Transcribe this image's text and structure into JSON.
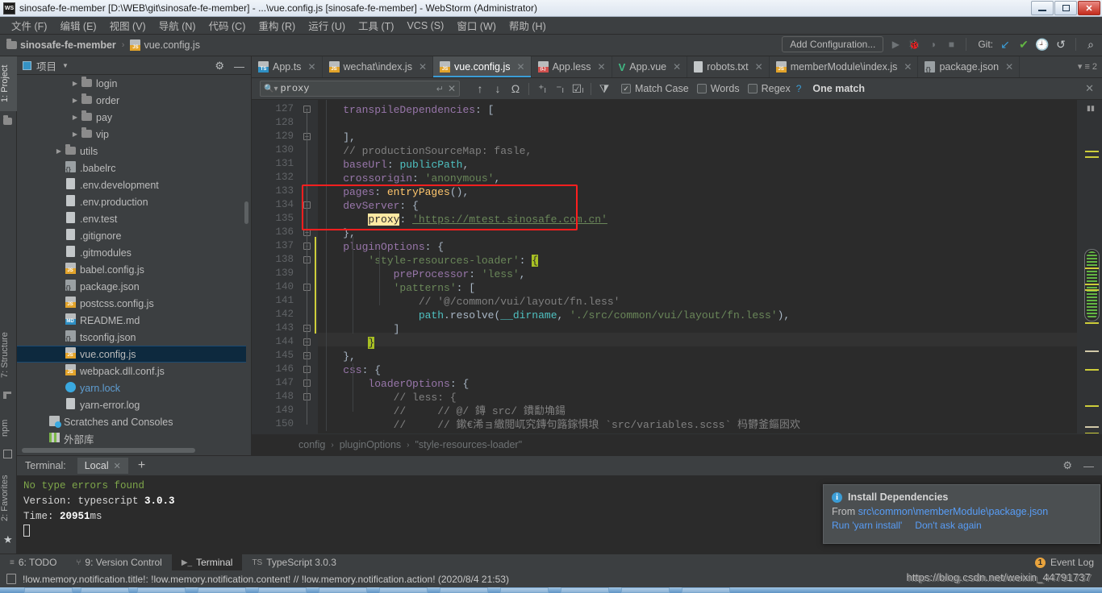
{
  "window": {
    "title": "sinosafe-fe-member [D:\\WEB\\git\\sinosafe-fe-member] - ...\\vue.config.js [sinosafe-fe-member] - WebStorm (Administrator)",
    "app_icon": "WS",
    "minimize": "minimize-icon",
    "maximize": "restore-icon",
    "close": "✕"
  },
  "menubar": [
    {
      "label": "文件 (F)"
    },
    {
      "label": "编辑 (E)"
    },
    {
      "label": "视图 (V)"
    },
    {
      "label": "导航 (N)"
    },
    {
      "label": "代码 (C)"
    },
    {
      "label": "重构 (R)"
    },
    {
      "label": "运行 (U)"
    },
    {
      "label": "工具 (T)"
    },
    {
      "label": "VCS (S)"
    },
    {
      "label": "窗口 (W)"
    },
    {
      "label": "帮助 (H)"
    }
  ],
  "navbar": {
    "breadcrumb_project": "sinosafe-fe-member",
    "breadcrumb_sep": "›",
    "breadcrumb_file": "vue.config.js",
    "add_configuration": "Add Configuration...",
    "git_label": "Git:",
    "icons": [
      "run-icon",
      "debug-icon",
      "run-coverage-icon",
      "stop-icon",
      "git-update-icon",
      "git-commit-icon",
      "git-history-icon",
      "git-rollback-icon",
      "search-everywhere-icon"
    ]
  },
  "left_strip": [
    {
      "label": "1: Project",
      "active": true
    },
    {
      "label": "7: Structure",
      "active": false
    },
    {
      "label": "npm",
      "active": false
    },
    {
      "label": "2: Favorites",
      "active": false
    }
  ],
  "project_panel": {
    "title": "项目",
    "settings_icon": "gear-icon",
    "hide_icon": "minimize-icon",
    "tree": [
      {
        "label": "login",
        "icon": "folder",
        "indent": 3,
        "arrow": true,
        "selected": false
      },
      {
        "label": "order",
        "icon": "folder",
        "indent": 3,
        "arrow": true,
        "selected": false
      },
      {
        "label": "pay",
        "icon": "folder",
        "indent": 3,
        "arrow": true,
        "selected": false
      },
      {
        "label": "vip",
        "icon": "folder",
        "indent": 3,
        "arrow": true,
        "selected": false
      },
      {
        "label": "utils",
        "icon": "folder",
        "indent": 2,
        "arrow": true,
        "selected": false
      },
      {
        "label": ".babelrc",
        "icon": "json",
        "indent": 2,
        "arrow": false,
        "selected": false
      },
      {
        "label": ".env.development",
        "icon": "txt",
        "indent": 2,
        "arrow": false,
        "selected": false
      },
      {
        "label": ".env.production",
        "icon": "txt",
        "indent": 2,
        "arrow": false,
        "selected": false
      },
      {
        "label": ".env.test",
        "icon": "txt",
        "indent": 2,
        "arrow": false,
        "selected": false
      },
      {
        "label": ".gitignore",
        "icon": "txt",
        "indent": 2,
        "arrow": false,
        "selected": false
      },
      {
        "label": ".gitmodules",
        "icon": "txt",
        "indent": 2,
        "arrow": false,
        "selected": false
      },
      {
        "label": "babel.config.js",
        "icon": "js",
        "indent": 2,
        "arrow": false,
        "selected": false
      },
      {
        "label": "package.json",
        "icon": "json",
        "indent": 2,
        "arrow": false,
        "selected": false
      },
      {
        "label": "postcss.config.js",
        "icon": "js",
        "indent": 2,
        "arrow": false,
        "selected": false
      },
      {
        "label": "README.md",
        "icon": "md",
        "indent": 2,
        "arrow": false,
        "selected": false
      },
      {
        "label": "tsconfig.json",
        "icon": "json",
        "indent": 2,
        "arrow": false,
        "selected": false
      },
      {
        "label": "vue.config.js",
        "icon": "js",
        "indent": 2,
        "arrow": false,
        "selected": true
      },
      {
        "label": "webpack.dll.conf.js",
        "icon": "js",
        "indent": 2,
        "arrow": false,
        "selected": false
      },
      {
        "label": "yarn.lock",
        "icon": "yarn",
        "indent": 2,
        "arrow": false,
        "selected": false
      },
      {
        "label": "yarn-error.log",
        "icon": "txt",
        "indent": 2,
        "arrow": false,
        "selected": false
      },
      {
        "label": "Scratches and Consoles",
        "icon": "scratch",
        "indent": 1,
        "arrow": false,
        "selected": false
      },
      {
        "label": "外部库",
        "icon": "lib",
        "indent": 1,
        "arrow": false,
        "selected": false
      }
    ]
  },
  "editor_tabs": [
    {
      "label": "App.ts",
      "icon": "ts",
      "active": false
    },
    {
      "label": "wechat\\index.js",
      "icon": "js",
      "active": false
    },
    {
      "label": "vue.config.js",
      "icon": "js",
      "active": true
    },
    {
      "label": "App.less",
      "icon": "less",
      "active": false
    },
    {
      "label": "App.vue",
      "icon": "vue",
      "active": false
    },
    {
      "label": "robots.txt",
      "icon": "txt",
      "active": false
    },
    {
      "label": "memberModule\\index.js",
      "icon": "js",
      "active": false
    },
    {
      "label": "package.json",
      "icon": "json",
      "active": false
    }
  ],
  "editor_tabs_overflow": "2",
  "find_bar": {
    "query": "proxy",
    "placeholder": "Find",
    "match_case": {
      "label": "Match Case",
      "checked": true
    },
    "words": {
      "label": "Words",
      "checked": false
    },
    "regex": {
      "label": "Regex",
      "checked": false
    },
    "help": "?",
    "result": "One match",
    "icons": [
      "prev-match-icon",
      "next-match-icon",
      "select-all-occurrences-icon",
      "add-line-icon",
      "remove-line-icon",
      "select-occurrences-icon",
      "filter-icon"
    ],
    "close": "✕"
  },
  "code": {
    "first_line_number": 127,
    "highlighted_line": 144,
    "lines": [
      {
        "n": 127,
        "html": "<span class='indent'>    </span><span class='prop'>transpileDependencies</span><span class='plain'>: [</span>"
      },
      {
        "n": 128,
        "html": ""
      },
      {
        "n": 129,
        "html": "<span class='plain'>    ],</span>"
      },
      {
        "n": 130,
        "html": "<span class='cm'>    // productionSourceMap: fasle,</span>"
      },
      {
        "n": 131,
        "html": "<span class='prop'>    baseUrl</span><span class='plain'>: </span><span class='teal'>publicPath</span><span class='plain'>,</span>"
      },
      {
        "n": 132,
        "html": "<span class='prop'>    crossorigin</span><span class='plain'>: </span><span class='str'>'anonymous'</span><span class='plain'>,</span>"
      },
      {
        "n": 133,
        "html": "<span class='prop'>    pages</span><span class='plain'>: </span><span class='fn'>entryPages</span><span class='plain'>(),</span>"
      },
      {
        "n": 134,
        "html": "<span class='prop'>    devServer</span><span class='plain'>: {</span>"
      },
      {
        "n": 135,
        "html": "<span class='plain'>        </span><span class='sel-hl'>proxy</span><span class='plain'>: </span><span class='str linkund'>'https://mtest.sinosafe.com.cn'</span>"
      },
      {
        "n": 136,
        "html": "<span class='plain'>    },</span>"
      },
      {
        "n": 137,
        "html": "<span class='prop'>    pluginOptions</span><span class='plain'>: {</span>"
      },
      {
        "n": 138,
        "html": "<span class='plain'>        </span><span class='str'>'style-resources-loader'</span><span class='plain'>: </span><span class='grn-hl'>{</span>"
      },
      {
        "n": 139,
        "html": "<span class='plain'>            </span><span class='prop'>preProcessor</span><span class='plain'>: </span><span class='str'>'less'</span><span class='plain'>,</span>"
      },
      {
        "n": 140,
        "html": "<span class='plain'>            </span><span class='str'>'patterns'</span><span class='plain'>: [</span>"
      },
      {
        "n": 141,
        "html": "<span class='cm'>                // '@/common/vui/layout/fn.less'</span>"
      },
      {
        "n": 142,
        "html": "<span class='plain'>                </span><span class='teal'>path</span><span class='plain'>.</span><span class='fn2'>resolve</span><span class='plain'>(</span><span class='teal'>__dirname</span><span class='plain'>, </span><span class='str'>'./src/common/vui/layout/fn.less'</span><span class='plain'>),</span>"
      },
      {
        "n": 143,
        "html": "<span class='plain'>            ]</span>"
      },
      {
        "n": 144,
        "html": "<span class='plain'>        </span><span class='grn-hl'>}</span>"
      },
      {
        "n": 145,
        "html": "<span class='plain'>    },</span>"
      },
      {
        "n": 146,
        "html": "<span class='prop'>    css</span><span class='plain'>: {</span>"
      },
      {
        "n": 147,
        "html": "<span class='plain'>        </span><span class='prop'>loaderOptions</span><span class='plain'>: {</span>"
      },
      {
        "n": 148,
        "html": "<span class='cm'>            // less: {</span>"
      },
      {
        "n": 149,
        "html": "<span class='cm'>            //     // @/ 鏄 src/ 鐨勫埆鍚</span>"
      },
      {
        "n": 150,
        "html": "<span class='cm'>            //     // 鏉€浠ョ繖閲屼究鏄句簬鎵惧埌 `src/variables.scss` 杩欎釜鏂囦欢</span>"
      }
    ]
  },
  "code_breadcrumbs": [
    "config",
    "pluginOptions",
    "\"style-resources-loader\""
  ],
  "terminal": {
    "label": "Terminal:",
    "tab": "Local",
    "add": "+",
    "settings_icon": "gear-icon",
    "hide_icon": "minimize-icon",
    "lines": [
      {
        "text": "No type errors found",
        "cls": "tgreen"
      },
      {
        "text": "Version: typescript ",
        "bold": "3.0.3",
        "cls": "twhite"
      },
      {
        "text": "Time: ",
        "bold": "20951",
        "tail": "ms",
        "cls": "twhite"
      }
    ]
  },
  "notification": {
    "icon": "info-icon",
    "title": "Install Dependencies",
    "from_label": "From ",
    "from_path": "src\\common\\memberModule\\package.json",
    "action_run": "Run 'yarn install'",
    "action_dismiss": "Don't ask again"
  },
  "status_bar": {
    "items": [
      {
        "label": "6: TODO",
        "icon": "todo-icon",
        "active": false
      },
      {
        "label": "9: Version Control",
        "icon": "branch-icon",
        "active": false
      },
      {
        "label": "Terminal",
        "icon": "terminal-icon",
        "active": true
      },
      {
        "label": "TypeScript 3.0.3",
        "icon": "ts-icon",
        "active": false
      }
    ],
    "event_log": "Event Log",
    "event_count": "1"
  },
  "message_bar": {
    "icon": "note-icon",
    "text": "!low.memory.notification.title!: !low.memory.notification.content! // !low.memory.notification.action! (2020/8/4 21:53)"
  },
  "watermark": "https://blog.csdn.net/weixin_44791737",
  "colors": {
    "accent": "#3b9dd6",
    "panel_bg": "#3c3f41",
    "editor_bg": "#2b2b2b",
    "selection": "#0d293e",
    "highlight_box": "#ff1f1f",
    "string": "#6a8759",
    "property": "#9876aa",
    "comment": "#808080"
  }
}
